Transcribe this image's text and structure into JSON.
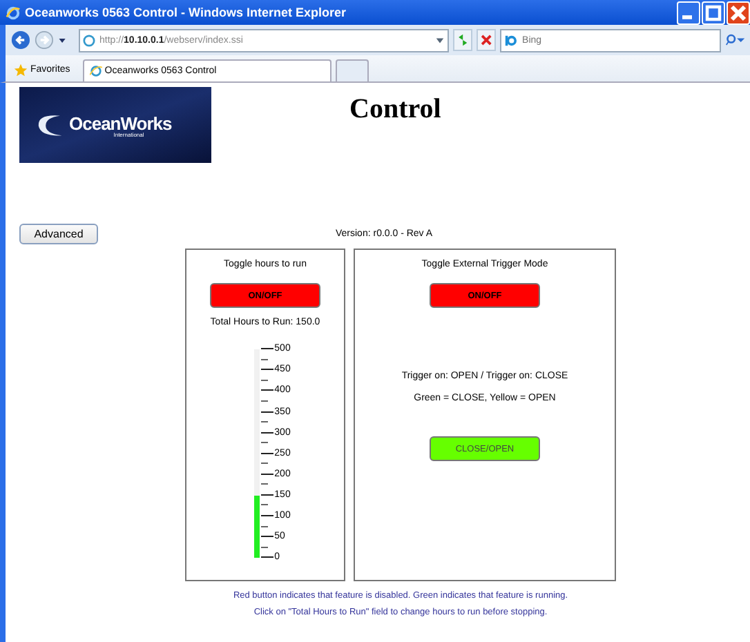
{
  "window": {
    "title": "Oceanworks 0563 Control - Windows Internet Explorer"
  },
  "address_bar": {
    "url_prefix": "http://",
    "url_host": "10.10.0.1",
    "url_path": "/webserv/index.ssi"
  },
  "search": {
    "placeholder": "Bing"
  },
  "favorites_bar": {
    "label": "Favorites",
    "tabs": [
      {
        "label": "Oceanworks 0563 Control",
        "selected": true
      },
      {
        "selected": false
      }
    ]
  },
  "page": {
    "logo": {
      "name": "OceanWorks",
      "tagline": "International"
    },
    "heading": "Control",
    "advanced_button": "Advanced",
    "version": "Version: r0.0.0 - Rev A",
    "hours_panel": {
      "title": "Toggle hours to run",
      "button": {
        "label": "ON/OFF",
        "on": false
      },
      "total": "Total Hours to Run: 150.0",
      "gauge": {
        "level": 0.3,
        "labels": [
          "500",
          "450",
          "400",
          "350",
          "300",
          "250",
          "200",
          "150",
          "100",
          "50",
          "0"
        ]
      }
    },
    "trigger_panel": {
      "title": "Toggle External Trigger Mode",
      "button": {
        "label": "ON/OFF",
        "on": false
      },
      "notes": [
        "Trigger on: OPEN / Trigger on: CLOSE",
        "Green = CLOSE, Yellow = OPEN"
      ],
      "state_button": {
        "label": "CLOSE/OPEN",
        "closed": true
      }
    },
    "footer": [
      "Red button indicates that feature is disabled.  Green indicates that feature is running.",
      "Click on \"Total Hours to Run\" field to change hours to run before stopping."
    ]
  }
}
